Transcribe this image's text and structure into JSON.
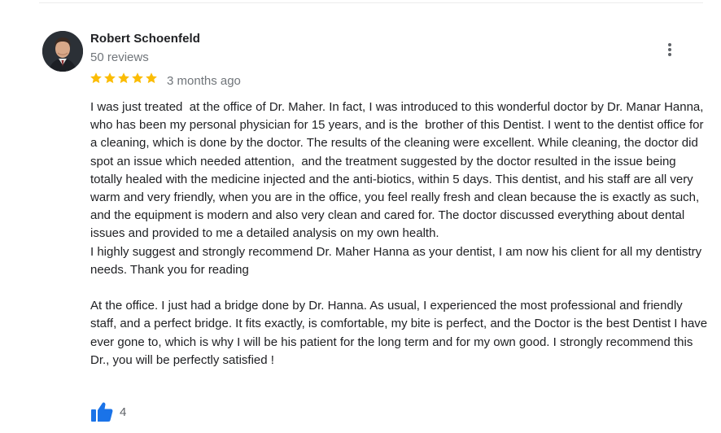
{
  "review": {
    "author": "Robert Schoenfeld",
    "reviews_count": "50 reviews",
    "rating": 5,
    "rating_max": 5,
    "date": "3 months ago",
    "body_paragraphs": [
      "I was just treated  at the office of Dr. Maher. In fact, I was introduced to this wonderful doctor by Dr. Manar Hanna, who has been my personal physician for 15 years, and is the  brother of this Dentist. I went to the dentist office for a cleaning, which is done by the doctor. The results of the cleaning were excellent. While cleaning, the doctor did spot an issue which needed attention,  and the treatment suggested by the doctor resulted in the issue being totally healed with the medicine injected and the anti-biotics, within 5 days. This dentist, and his staff are all very warm and very friendly, when you are in the office, you feel really fresh and clean because the is exactly as such, and the equipment is modern and also very clean and cared for. The doctor discussed everything about dental issues and provided to me a detailed analysis on my own health.",
      "I highly suggest and strongly recommend Dr. Maher Hanna as your dentist, I am now his client for all my dentistry needs. Thank you for reading",
      "",
      "At the office. I just had a bridge done by Dr. Hanna. As usual, I experienced the most professional and friendly staff, and a perfect bridge. It fits exactly, is comfortable, my bite is perfect, and the Doctor is the best Dentist I have ever gone to, which is why I will be his patient for the long term and for my own good. I strongly recommend this Dr., you will be perfectly satisfied !"
    ],
    "likes": "4"
  },
  "icons": {
    "avatar": "profile-photo",
    "more": "more-vert-icon",
    "star": "star-icon",
    "like": "thumbs-up-icon"
  },
  "colors": {
    "star": "#fbbc04",
    "like": "#1a73e8",
    "secondary_text": "#70757a",
    "primary_text": "#202124"
  }
}
